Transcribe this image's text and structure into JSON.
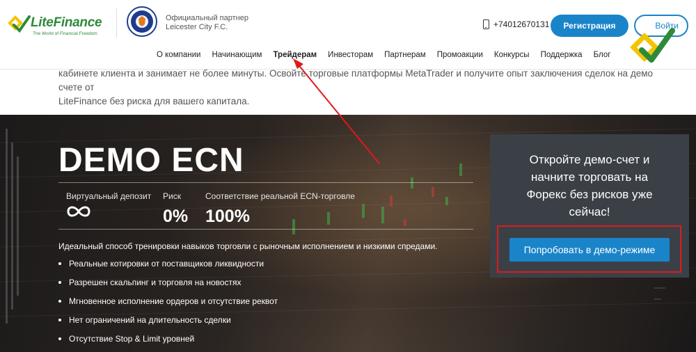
{
  "header": {
    "logo": {
      "brand": "LiteFinance",
      "tagline": "The World of Financial Freedom"
    },
    "partner": {
      "line1": "Официальный партнер",
      "line2": "Leicester City F.C."
    },
    "phone": "+74012670131",
    "register_label": "Регистрация",
    "login_label": "Войти"
  },
  "nav": {
    "items": [
      "О компании",
      "Начинающим",
      "Трейдерам",
      "Инвесторам",
      "Партнерам",
      "Промоакции",
      "Конкурсы",
      "Поддержка",
      "Блог"
    ],
    "active_index": 2
  },
  "intro": {
    "line1": "кабинете клиента и занимает не более минуты. Освойте торговые платформы MetaTrader и получите опыт заключения сделок на демо счете от",
    "line2": "LiteFinance без риска для вашего капитала."
  },
  "hero": {
    "title": "DEMO ECN",
    "stats": [
      {
        "label": "Виртуальный депозит",
        "value": "∞"
      },
      {
        "label": "Риск",
        "value": "0%"
      },
      {
        "label": "Соответствие реальной ECN-торговле",
        "value": "100%"
      }
    ],
    "lead": "Идеальный способ тренировки навыков торговли с рыночным исполнением и низкими спредами.",
    "features": [
      "Реальные котировки от поставщиков ликвидности",
      "Разрешен скальпинг и торговля на новостях",
      "Мгновенное исполнение ордеров и отсутствие реквот",
      "Нет ограничений на длительность сделки",
      "Отсутствие Stop & Limit уровней"
    ]
  },
  "demo_panel": {
    "heading_lines": [
      "Откройте демо-счет и",
      "начните торговать на",
      "Форекс без рисков уже",
      "сейчас!"
    ],
    "button_label": "Попробовать в демо-режиме"
  },
  "colors": {
    "accent_blue": "#1a84c9",
    "brand_green": "#2d8a3a",
    "annotation_red": "#e0191b",
    "panel_bg": "#3b4047"
  }
}
